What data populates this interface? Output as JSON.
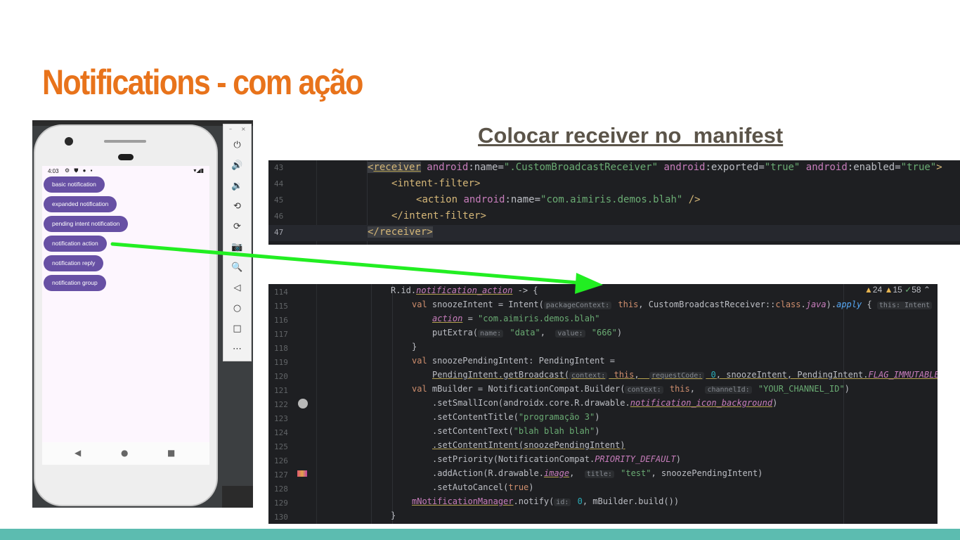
{
  "slide": {
    "title": "Notifications - com ação",
    "accent_color": "#e8731b",
    "bottom_bar_color": "#5cbcb0"
  },
  "emulator": {
    "status": {
      "time": "4:03",
      "icons": "⚙ ⛊ ● ▪",
      "right_icons": "▾◢▮"
    },
    "buttons": [
      {
        "label": "basic notification"
      },
      {
        "label": "expanded notification"
      },
      {
        "label": "pending intent notification"
      },
      {
        "label": "notification action"
      },
      {
        "label": "notification reply"
      },
      {
        "label": "notification group"
      }
    ],
    "navbar": {
      "back": "◀",
      "home": "●",
      "recents": "■"
    },
    "window_controls": {
      "minimize": "–",
      "close": "×"
    },
    "toolbar": [
      {
        "name": "power-icon",
        "glyph": "⏻"
      },
      {
        "name": "volume-up-icon",
        "glyph": "🔊"
      },
      {
        "name": "volume-down-icon",
        "glyph": "🔉"
      },
      {
        "name": "rotate-left-icon",
        "glyph": "⟲"
      },
      {
        "name": "rotate-right-icon",
        "glyph": "⟳"
      },
      {
        "name": "camera-icon",
        "glyph": "📷"
      },
      {
        "name": "zoom-icon",
        "glyph": "🔍"
      },
      {
        "name": "back-icon",
        "glyph": "◁"
      },
      {
        "name": "home-icon",
        "glyph": "○"
      },
      {
        "name": "overview-icon",
        "glyph": "□"
      },
      {
        "name": "more-icon",
        "glyph": "⋯"
      }
    ]
  },
  "manifest_heading": "Colocar receiver no  manifest",
  "manifest_code": {
    "line_numbers": [
      "43",
      "44",
      "45",
      "46",
      "47"
    ],
    "l43": {
      "open": "<",
      "tag": "receiver",
      "a1": " android",
      "c1": ":name=",
      "v1": "\".CustomBroadcastReceiver\"",
      "a2": " android",
      "c2": ":exported=",
      "v2": "\"true\"",
      "a3": " android",
      "c3": ":enabled=",
      "v3": "\"true\"",
      "close": ">"
    },
    "l44": {
      "open": "<",
      "tag": "intent-filter",
      "close": ">"
    },
    "l45": {
      "open": "<",
      "tag": "action",
      "a1": " android",
      "c1": ":name=",
      "v1": "\"com.aimiris.demos.blah\"",
      "close": " />"
    },
    "l46": {
      "open": "</",
      "tag": "intent-filter",
      "close": ">"
    },
    "l47": {
      "text": "</receiver>"
    }
  },
  "kotlin_code": {
    "line_numbers": [
      "114",
      "115",
      "116",
      "117",
      "118",
      "119",
      "120",
      "121",
      "122",
      "123",
      "124",
      "125",
      "126",
      "127",
      "128",
      "129",
      "130"
    ],
    "inspections": {
      "warnings": "24",
      "weak_warnings": "15",
      "checks": "58"
    },
    "l114": {
      "a": "R.id.",
      "b": "notification_action",
      "c": " -> {"
    },
    "l115": {
      "kw": "val",
      "a": " snoozeIntent = Intent(",
      "h1": "packageContext:",
      "b": " this",
      "c": ", CustomBroadcastReceiver::",
      "d": "class",
      "e": ".",
      "f": "java",
      "g": ").",
      "h": "apply",
      "i": " { ",
      "h2": "this: Intent"
    },
    "l116": {
      "a": "action",
      "b": " = ",
      "c": "\"com.aimiris.demos.blah\""
    },
    "l117": {
      "a": "putExtra(",
      "h1": "name:",
      "b": " \"data\"",
      "c": ",  ",
      "h2": "value:",
      "d": " \"666\"",
      "e": ")"
    },
    "l118": {
      "a": "}"
    },
    "l119": {
      "kw": "val",
      "a": " snoozePendingIntent: PendingIntent ="
    },
    "l120": {
      "a": "PendingIntent.getBroadcast(",
      "h1": "context:",
      "b": " this",
      "c": ",  ",
      "h2": "requestCode:",
      "d": " 0",
      "e": ", snoozeIntent, PendingIntent.",
      "f": "FLAG_IMMUTABLE",
      "g": ")"
    },
    "l121": {
      "kw": "val",
      "a": " mBuilder = NotificationCompat.Builder(",
      "h1": "context:",
      "b": " this",
      "c": ",  ",
      "h2": "channelId:",
      "d": " \"YOUR_CHANNEL_ID\"",
      "e": ")"
    },
    "l122": {
      "a": ".setSmallIcon(androidx.core.R.drawable.",
      "b": "notification_icon_background",
      "c": ")"
    },
    "l123": {
      "a": ".setContentTitle(",
      "b": "\"programação 3\"",
      "c": ")"
    },
    "l124": {
      "a": ".setContentText(",
      "b": "\"blah blah blah\"",
      "c": ")"
    },
    "l125": {
      "a": ".setContentIntent(snoozePendingIntent)"
    },
    "l126": {
      "a": ".setPriority(NotificationCompat.",
      "b": "PRIORITY_DEFAULT",
      "c": ")"
    },
    "l127": {
      "a": ".addAction(R.drawable.",
      "b": "image",
      "c": ",  ",
      "h1": "title:",
      "d": " \"test\"",
      "e": ", snoozePendingIntent)"
    },
    "l128": {
      "a": ".setAutoCancel(",
      "b": "true",
      "c": ")"
    },
    "l129": {
      "a": "mNotificationManager",
      "b": ".notify(",
      "h1": "id:",
      "c": " 0",
      "d": ", mBuilder.build())"
    },
    "l130": {
      "a": "}"
    }
  },
  "arrow_color": "#22ee22"
}
